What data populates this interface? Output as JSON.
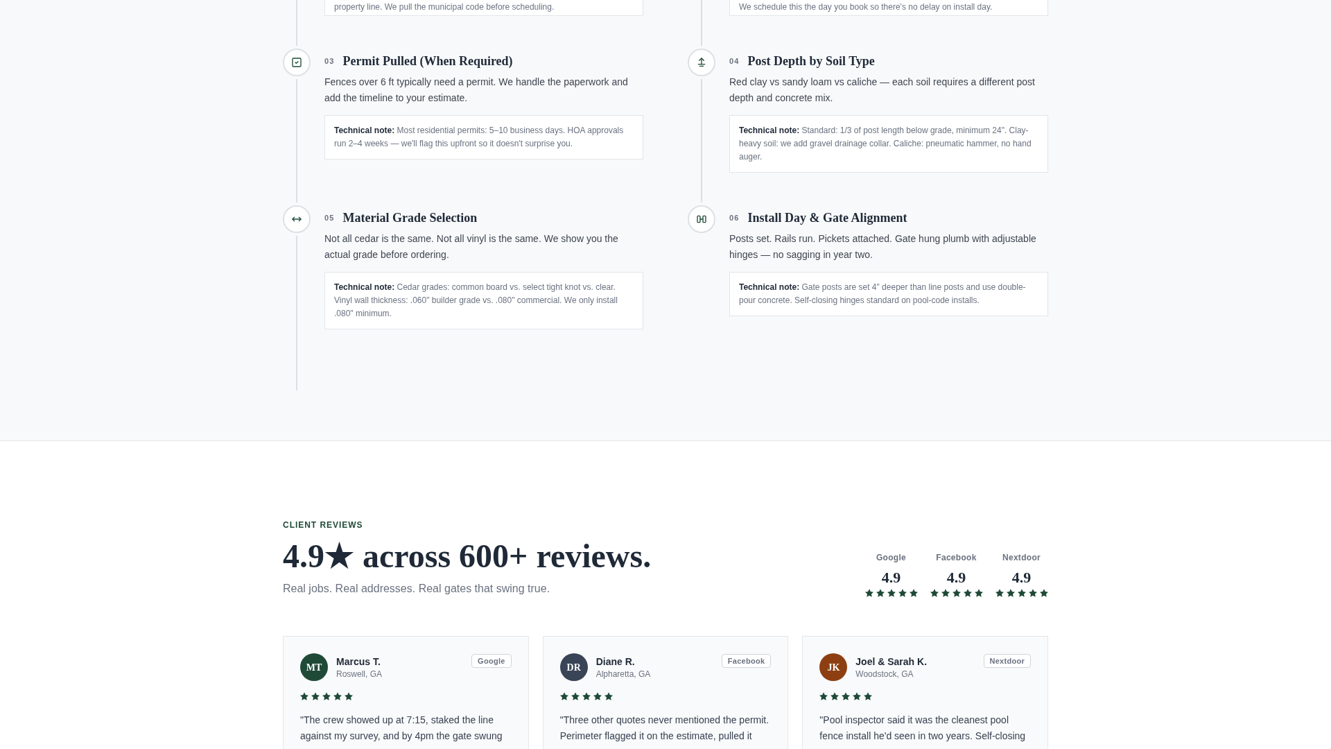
{
  "process": {
    "previous_step_notes": [
      {
        "note": "property line. We pull the municipal code before scheduling."
      },
      {
        "note": "We schedule this the day you book so there's no delay on install day."
      }
    ],
    "steps": [
      {
        "number": "03",
        "title": "Permit Pulled (When Required)",
        "description": "Fences over 6 ft typically need a permit. We handle the paperwork and add the timeline to your estimate.",
        "note": "**Technical note:** Most residential permits: 5–10 business days. HOA approvals run 2–4 weeks — we'll flag this upfront so it doesn't surprise you."
      },
      {
        "number": "04",
        "title": "Post Depth by Soil Type",
        "description": "Red clay vs sandy loam vs caliche — each soil requires a different post depth and concrete mix.",
        "note": "**Technical note:** Standard: 1/3 of post length below grade, minimum 24\". Clay-heavy soil: we add gravel drainage collar. Caliche: pneumatic hammer, no hand auger."
      },
      {
        "number": "05",
        "title": "Material Grade Selection",
        "description": "Not all cedar is the same. Not all vinyl is the same. We show you the actual grade before ordering.",
        "note": "**Technical note:** Cedar grades: common board vs. select tight knot vs. clear. Vinyl wall thickness: .060\" builder grade vs. .080\" commercial. We only install .080\" minimum."
      },
      {
        "number": "06",
        "title": "Install Day & Gate Alignment",
        "description": "Posts set. Rails run. Pickets attached. Gate hung plumb with adjustable hinges — no sagging in year two.",
        "note": "**Technical note:** Gate posts are set 4\" deeper than line posts and use double-pour concrete. Self-closing hinges standard on pool-code installs."
      }
    ]
  },
  "reviews": {
    "eyebrow": "CLIENT REVIEWS",
    "heading": "4.9★ across 600+ reviews.",
    "subheading": "Real jobs. Real addresses. Real gates that swing true.",
    "platforms": [
      {
        "name": "Google",
        "rating": "4.9",
        "stars": 5
      },
      {
        "name": "Facebook",
        "rating": "4.9",
        "stars": 5
      },
      {
        "name": "Nextdoor",
        "rating": "4.9",
        "stars": 5
      }
    ],
    "cards": [
      {
        "initials": "MT",
        "color": "#1f4a37",
        "name": "Marcus T.",
        "location": "Roswell, GA",
        "platform": "Google",
        "stars": 5,
        "quote": "\"The crew showed up at 7:15, staked the line against my survey, and by 4pm the gate swung"
      },
      {
        "initials": "DR",
        "color": "#394456",
        "name": "Diane R.",
        "location": "Alpharetta, GA",
        "platform": "Facebook",
        "stars": 5,
        "quote": "\"Three other quotes never mentioned the permit. Perimeter flagged it on the estimate, pulled it"
      },
      {
        "initials": "JK",
        "color": "#8e3f12",
        "name": "Joel & Sarah K.",
        "location": "Woodstock, GA",
        "platform": "Nextdoor",
        "stars": 5,
        "quote": "\"Pool inspector said it was the cleanest pool fence install he'd seen in two years. Self-closing"
      }
    ]
  }
}
